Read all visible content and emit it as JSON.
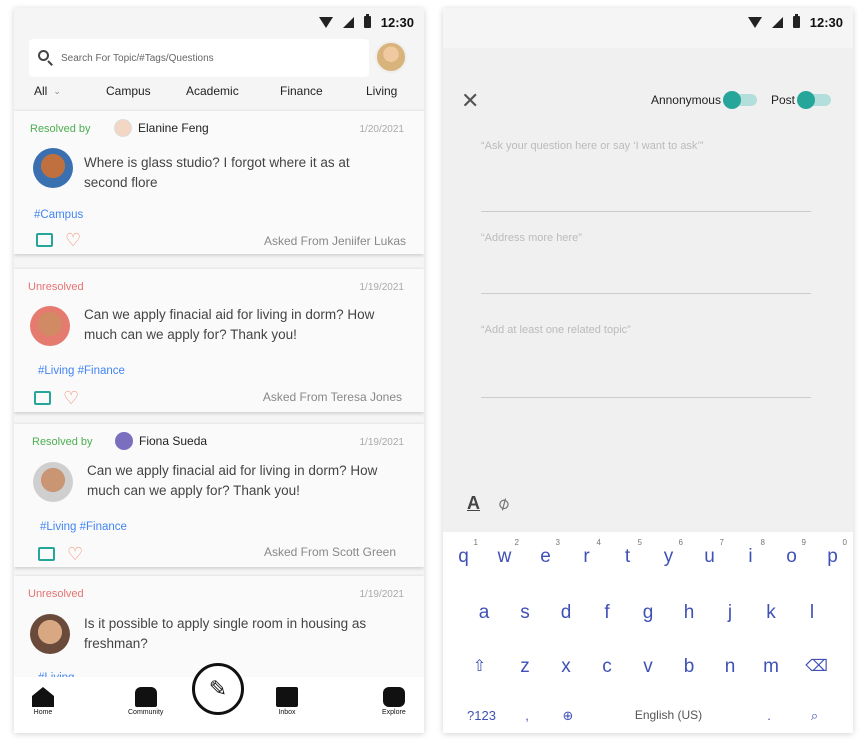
{
  "left": {
    "status_time": "12:30",
    "search_placeholder": "Search For Topic/#Tags/Questions",
    "categories": [
      "All",
      "Campus",
      "Academic",
      "Finance",
      "Living"
    ],
    "cards": [
      {
        "status": "Resolved by",
        "resolver": "Elanine Feng",
        "date": "1/20/2021",
        "question": "Where is glass studio? I forgot where it as at second flore",
        "tags": "#Campus",
        "asked_from": "Asked From Jeniifer Lukas"
      },
      {
        "status": "Unresolved",
        "resolver": "",
        "date": "1/19/2021",
        "question": "Can we apply finacial aid for living in dorm? How much can we apply for? Thank you!",
        "tags": "#Living #Finance",
        "asked_from": "Asked From Teresa Jones"
      },
      {
        "status": "Resolved by",
        "resolver": "Fiona Sueda",
        "date": "1/19/2021",
        "question": "Can we apply finacial aid for living in dorm? How much can we apply for? Thank you!",
        "tags": "#Living #Finance",
        "asked_from": "Asked From Scott Green"
      },
      {
        "status": "Unresolved",
        "resolver": "",
        "date": "1/19/2021",
        "question": "Is it possible to apply single room in housing as freshman?",
        "tags": "#Living",
        "asked_from": ""
      }
    ],
    "nav": {
      "home": "Home",
      "community": "Community",
      "inbox": "Inbox",
      "explore": "Explore"
    }
  },
  "right": {
    "status_time": "12:30",
    "anonymous_label": "Annonymous",
    "post_label": "Post",
    "fields": [
      "“Ask your question here or say ‘I want to ask’”",
      "“Address more here”",
      "“Add at least one related topic”"
    ],
    "keyboard": {
      "row1": [
        "q",
        "w",
        "e",
        "r",
        "t",
        "y",
        "u",
        "i",
        "o",
        "p"
      ],
      "row1_hints": [
        "1",
        "2",
        "3",
        "4",
        "5",
        "6",
        "7",
        "8",
        "9",
        "0"
      ],
      "row2": [
        "a",
        "s",
        "d",
        "f",
        "g",
        "h",
        "j",
        "k",
        "l"
      ],
      "row3": [
        "z",
        "x",
        "c",
        "v",
        "b",
        "n",
        "m"
      ],
      "symbols": "?123",
      "comma": ",",
      "space": "English (US)",
      "period": "."
    }
  },
  "colors": {
    "accent": "#26a69a",
    "resolved": "#4caf50",
    "unresolved": "#e57373",
    "tag": "#4285f4",
    "keys": "#3f51b5"
  }
}
